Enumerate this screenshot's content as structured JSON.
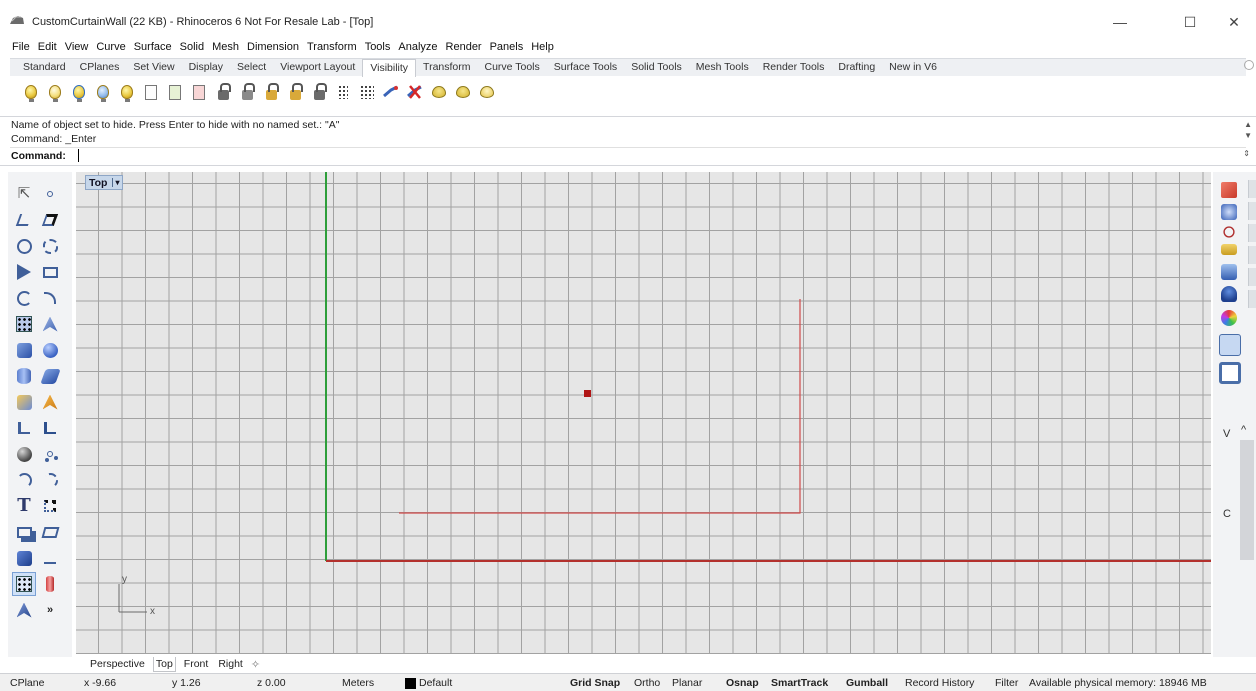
{
  "window": {
    "title": "CustomCurtainWall (22 KB) - Rhinoceros 6 Not For Resale Lab - [Top]",
    "controls": {
      "minimize": "—",
      "maximize": "☐",
      "close": "✕"
    }
  },
  "menu": [
    "File",
    "Edit",
    "View",
    "Curve",
    "Surface",
    "Solid",
    "Mesh",
    "Dimension",
    "Transform",
    "Tools",
    "Analyze",
    "Render",
    "Panels",
    "Help"
  ],
  "toolbar_tabs": {
    "items": [
      "Standard",
      "CPlanes",
      "Set View",
      "Display",
      "Select",
      "Viewport Layout",
      "Visibility",
      "Transform",
      "Curve Tools",
      "Surface Tools",
      "Solid Tools",
      "Mesh Tools",
      "Render Tools",
      "Drafting",
      "New in V6"
    ],
    "active": "Visibility"
  },
  "command": {
    "history_line_1": "Name of object set to hide. Press Enter to hide with no named set.: \"A\"",
    "history_line_2": "Command: _Enter",
    "prompt_label": "Command:",
    "input_value": ""
  },
  "viewport": {
    "label": "Top",
    "dropdown_glyph": "▾",
    "axis_x": "x",
    "axis_y": "y",
    "colors": {
      "background": "#e6e6e6",
      "grid": "#a2a2a2",
      "x_axis": "#b3312d",
      "y_axis": "#2e9e3a",
      "curve": "#cf4a4a",
      "point": "#b01515"
    }
  },
  "right_panel": {
    "letter_v": "V",
    "letter_c": "C",
    "up_glyph": "^"
  },
  "view_tabs": {
    "items": [
      "Perspective",
      "Top",
      "Front",
      "Right"
    ],
    "active": "Top",
    "add_glyph": "✧"
  },
  "status": {
    "cplane": "CPlane",
    "x": "x -9.66",
    "y": "y 1.26",
    "z": "z 0.00",
    "units": "Meters",
    "layer": "Default",
    "layer_color": "#000000",
    "grid_snap": "Grid Snap",
    "ortho": "Ortho",
    "planar": "Planar",
    "osnap": "Osnap",
    "smarttrack": "SmartTrack",
    "gumball": "Gumball",
    "record_history": "Record History",
    "filter": "Filter",
    "memory": "Available physical memory: 18946 MB"
  }
}
